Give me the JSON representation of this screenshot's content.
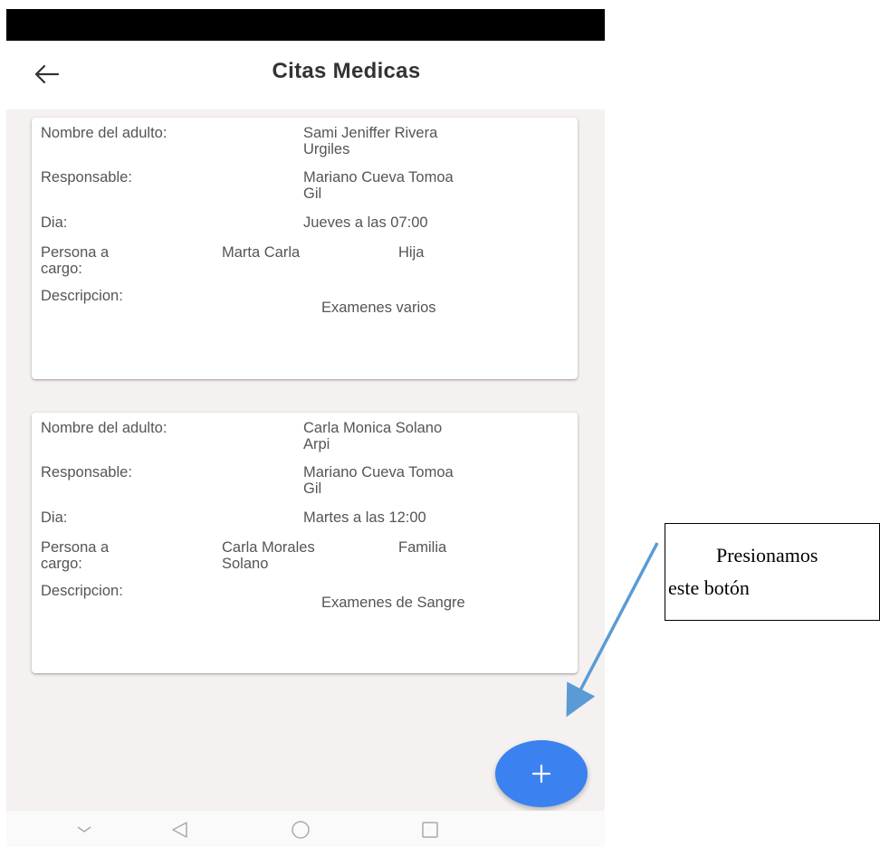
{
  "app_bar": {
    "title": "Citas Medicas",
    "back_icon": "arrow-left-icon"
  },
  "labels": {
    "adult": "Nombre del adulto:",
    "responsible": "Responsable:",
    "day": "Dia:",
    "person_in_charge_line1": "Persona a",
    "person_in_charge_line2": "cargo:",
    "description": "Descripcion:"
  },
  "appointments": [
    {
      "adult_line1": "Sami Jeniffer Rivera",
      "adult_line2": "Urgiles",
      "responsible_line1": "Mariano Cueva Tomoa",
      "responsible_line2": "Gil",
      "day": "Jueves a las 07:00",
      "person_line1": "Marta Carla",
      "person_line2": "",
      "relationship": "Hija",
      "description": "Examenes varios"
    },
    {
      "adult_line1": "Carla Monica Solano",
      "adult_line2": "Arpi",
      "responsible_line1": "Mariano Cueva Tomoa",
      "responsible_line2": "Gil",
      "day": "Martes a las 12:00",
      "person_line1": "Carla Morales",
      "person_line2": "Solano",
      "relationship": "Familia",
      "description": "Examenes de Sangre"
    }
  ],
  "fab": {
    "icon": "plus-icon",
    "color": "#3b82f0"
  },
  "nav_bar": {
    "icons": [
      "hide-keyboard-icon",
      "back-triangle-icon",
      "home-circle-icon",
      "recents-square-icon"
    ]
  },
  "callout": {
    "line1": "Presionamos",
    "line2": "este botón",
    "arrow_color": "#5b9bd5"
  }
}
